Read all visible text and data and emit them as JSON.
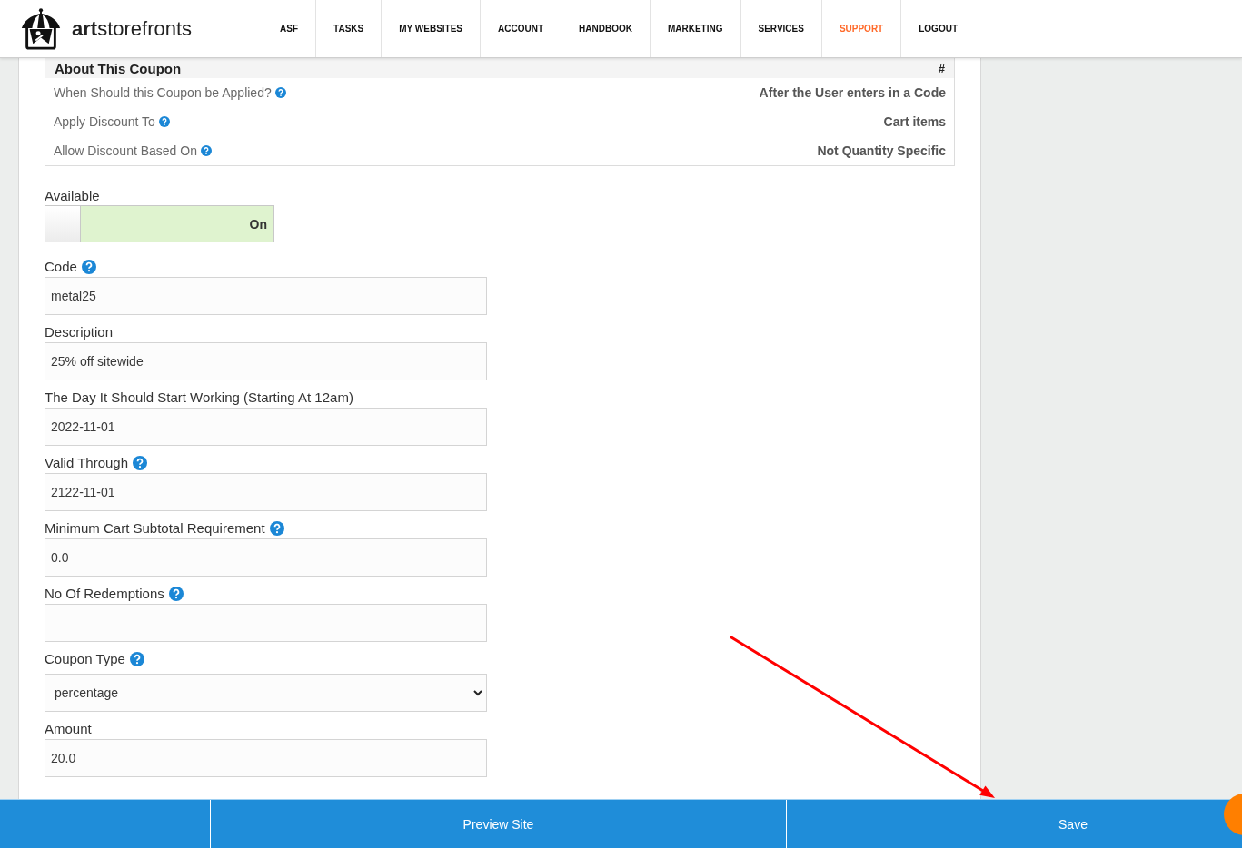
{
  "header": {
    "logo_text": "**art**storefronts",
    "nav": [
      {
        "label": "ASF",
        "selected": false
      },
      {
        "label": "TASKS",
        "selected": false
      },
      {
        "label": "MY WEBSITES",
        "selected": false
      },
      {
        "label": "ACCOUNT",
        "selected": false
      },
      {
        "label": "HANDBOOK",
        "selected": false
      },
      {
        "label": "MARKETING",
        "selected": false
      },
      {
        "label": "SERVICES",
        "selected": false
      },
      {
        "label": "SUPPORT",
        "selected": true
      },
      {
        "label": "LOGOUT",
        "selected": false
      }
    ]
  },
  "coupon_summary": {
    "title": "About This Coupon",
    "column_2": "#",
    "rows": [
      {
        "label": "When Should this Coupon be Applied?",
        "help": true,
        "value": "After the User enters in a Code"
      },
      {
        "label": "Apply Discount To",
        "help": true,
        "value": "Cart items"
      },
      {
        "label": "Allow Discount Based On",
        "help": true,
        "value": "Not Quantity Specific"
      }
    ]
  },
  "available": {
    "label": "Available",
    "on": true,
    "state_text": "On"
  },
  "fields": [
    {
      "label": "Code",
      "help": true,
      "kind": "text",
      "value": "metal25"
    },
    {
      "label": "Description",
      "help": false,
      "kind": "text",
      "value": "25% off sitewide"
    },
    {
      "label": "The Day It Should Start Working (Starting At 12am)",
      "help": false,
      "kind": "text",
      "value": "2022-11-01"
    },
    {
      "label": "Valid Through",
      "help": true,
      "kind": "text",
      "value": "2122-11-01"
    },
    {
      "label": "Minimum Cart Subtotal Requirement",
      "help": true,
      "kind": "text",
      "value": "0.0"
    },
    {
      "label": "No Of Redemptions",
      "help": true,
      "kind": "text"
    },
    {
      "label": "Coupon Type",
      "help": true,
      "kind": "select",
      "value": "percentage"
    },
    {
      "label": "Amount",
      "help": false,
      "kind": "text",
      "value": "20.0"
    }
  ],
  "footer_actions": [
    {
      "label": "Preview Site"
    },
    {
      "label": "Save"
    }
  ]
}
